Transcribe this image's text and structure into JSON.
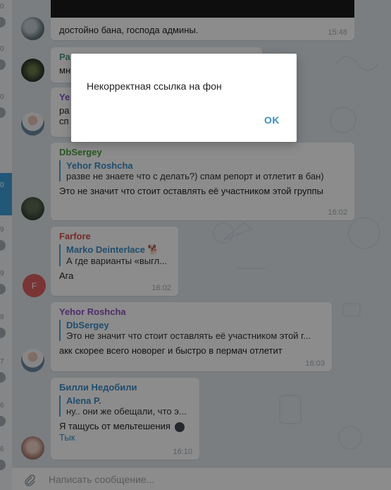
{
  "chat_list_strip": {
    "items": [
      {
        "num": "0",
        "active": false
      },
      {
        "num": "0",
        "active": false
      },
      {
        "num": "0",
        "active": false
      },
      {
        "num": "0",
        "active": true
      },
      {
        "num": "9",
        "active": false
      },
      {
        "num": "9",
        "active": false
      },
      {
        "num": "8",
        "active": false
      },
      {
        "num": "7",
        "active": false
      },
      {
        "num": "6",
        "active": false
      },
      {
        "num": "6",
        "active": false
      }
    ]
  },
  "messages": [
    {
      "text": "достойно бана, господа админы.",
      "time": "15:48"
    },
    {
      "sender": "Ра",
      "text": "мн"
    },
    {
      "sender": "Ye",
      "text_lines": [
        "ра",
        "сп"
      ]
    },
    {
      "sender": "DbSergey",
      "reply_name": "Yehor Roshcha",
      "reply_text": "разве не знаете что с делать?) спам репорт и отлетит в бан)",
      "text": "Это не значит что стоит оставлять её участником этой группы",
      "time": "16:02"
    },
    {
      "sender": "Farfore",
      "reply_name": "Marko Deinterlace 🐕",
      "reply_text": "А где варианты «выгл...",
      "text": "Ага",
      "time": "16:02",
      "avatar_letter": "F"
    },
    {
      "sender": "Yehor Roshcha",
      "reply_name": "DbSergey",
      "reply_text": "Это не значит что стоит оставлять её участником этой г...",
      "text": "акк скорее всего новорег и быстро в пермач отлетит",
      "time": "16:03"
    },
    {
      "sender": "Билли Недобили",
      "reply_name": "Alena P.",
      "reply_text": "ну.. они же обещали, что э...",
      "text": "Я тащусь от мельтешения",
      "link": "Тык",
      "time": "16:10"
    }
  ],
  "composer": {
    "placeholder": "Написать сообщение..."
  },
  "dialog": {
    "message": "Некорректная ссылка на фон",
    "ok_label": "OK"
  },
  "colors": {
    "accent": "#3a8fc7",
    "dbsergey": "#4ba03c",
    "farfore": "#d84c4c",
    "yehor": "#8a55c2",
    "billi": "#3a8fc7"
  }
}
